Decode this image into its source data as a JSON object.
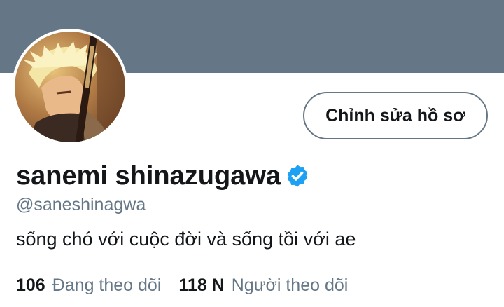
{
  "profile": {
    "edit_button_label": "Chỉnh sửa hồ sơ",
    "display_name": "sanemi shinazugawa",
    "verified": true,
    "handle": "@saneshinagwa",
    "bio": "sống chó với cuộc đời và sống tồi với ae",
    "following_count": "106",
    "following_label": "Đang theo dõi",
    "followers_count": "118 N",
    "followers_label": "Người theo dõi"
  },
  "colors": {
    "banner": "#657786",
    "verified_badge": "#1da1f2",
    "primary_text": "#14171a",
    "secondary_text": "#657786"
  },
  "icons": {
    "verified": "verified-badge-icon"
  }
}
